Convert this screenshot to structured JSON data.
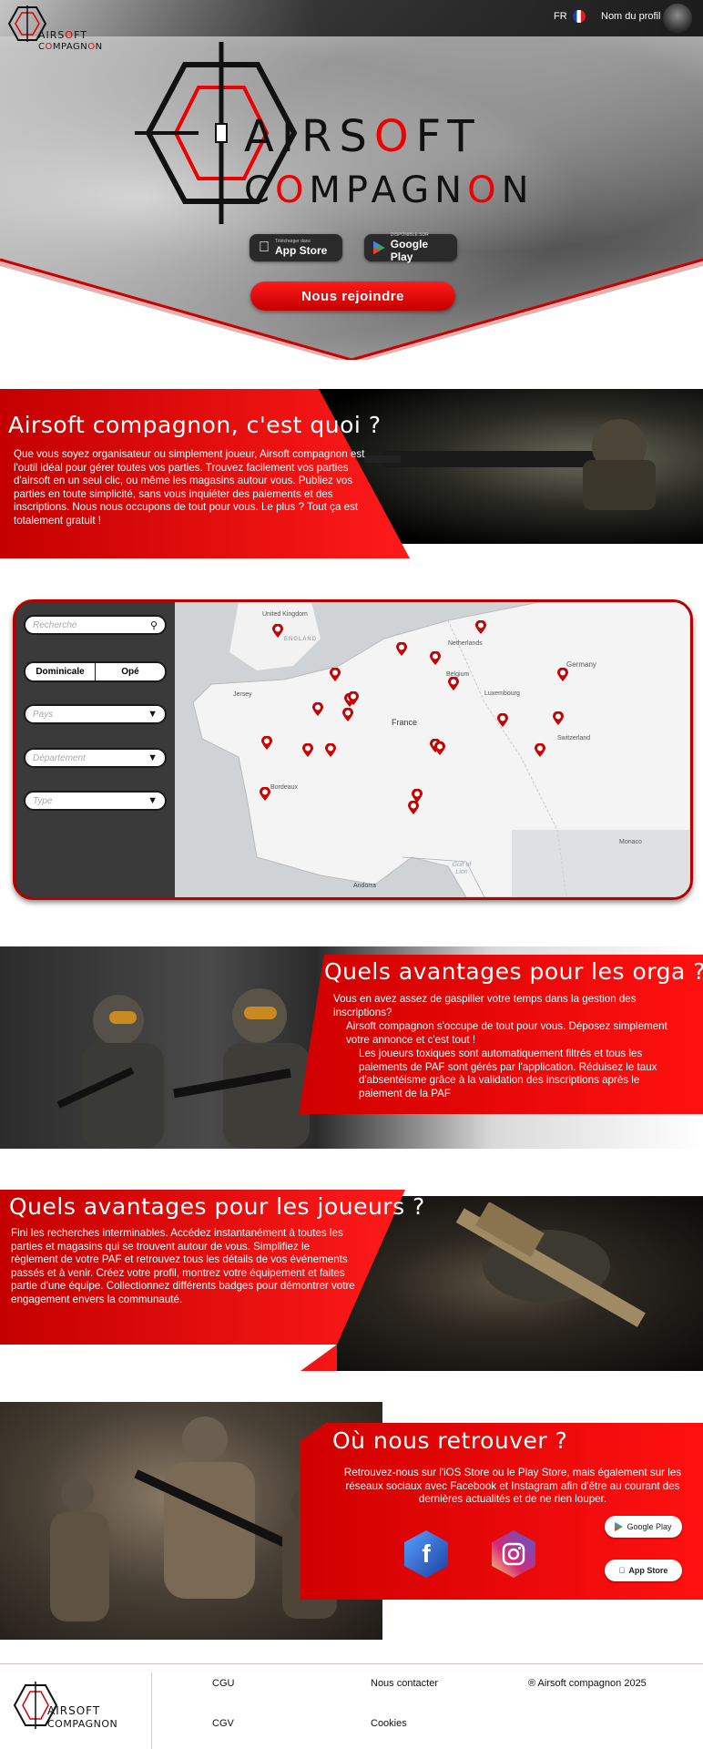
{
  "header": {
    "language": "FR",
    "profile_label": "Nom du profil"
  },
  "hero": {
    "logo_line1": "AIRSOFT",
    "logo_line2": "COMPAGNON",
    "app_store": {
      "small": "Télécharger dans",
      "label": "App Store"
    },
    "google_play": {
      "small": "DISPONIBLE SUR",
      "label": "Google Play"
    },
    "join_button": "Nous rejoindre"
  },
  "about": {
    "title": "Airsoft compagnon, c'est quoi ?",
    "text": "Que vous soyez organisateur ou simplement joueur, Airsoft compagnon est l'outil idéal pour gérer toutes vos parties. Trouvez facilement vos parties d'airsoft en un seul clic, ou même les magasins autour vous. Publiez vos parties en toute simplicité, sans vous inquiéter des paiements et des inscriptions. Nous nous occupons de tout pour vous. Le plus ? Tout ça est totalement gratuit !"
  },
  "search": {
    "search_placeholder": "Recherche",
    "segment": [
      "Dominicale",
      "Opé"
    ],
    "selects": [
      "Pays",
      "Département",
      "Type"
    ],
    "map_labels": [
      "United Kingdom",
      "ENGLAND",
      "Netherlands",
      "Belgium",
      "Luxembourg",
      "Germany",
      "Jersey",
      "France",
      "Switzerland",
      "Bordeaux",
      "Monaco",
      "Andorra",
      "Gulf of Lion"
    ]
  },
  "orga": {
    "title": "Quels avantages pour les orga ?",
    "p1": "Vous en avez assez de gaspiller votre temps dans la gestion des inscriptions?",
    "p2": "Airsoft compagnon s'occupe de tout pour vous. Déposez simplement votre annonce et c'est tout !",
    "p3": "Les joueurs toxiques sont automatiquement filtrés et tous les paiements de PAF sont gérés par l'application.  Réduisez le taux d'absentéisme grâce à la validation des inscriptions après le paiement de la PAF"
  },
  "players": {
    "title": "Quels avantages pour les joueurs ?",
    "text": "Fini les recherches interminables. Accédez instantanément à toutes les parties et magasins qui se trouvent autour de vous. Simplifiez le règlement de votre PAF et retrouvez tous les détails de vos événements passés et à venir. Créez votre profil, montrez votre équipement et faites partie d'une équipe. Collectionnez différents badges pour démontrer votre engagement envers la communauté."
  },
  "find": {
    "title": "Où nous retrouver ?",
    "text": "Retrouvez-nous sur l'iOS Store ou le Play Store, mais également sur les réseaux sociaux avec Facebook et Instagram afin d'être au courant des dernières actualités et de ne rien louper.",
    "facebook": "f",
    "google_play": "Google Play",
    "app_store": "App Store"
  },
  "footer": {
    "logo_line1": "AIRSOFT",
    "logo_line2": "COMPAGNON",
    "cgu": "CGU",
    "cgv": "CGV",
    "contact": "Nous contacter",
    "cookies": "Cookies",
    "copyright": "® Airsoft compagnon 2025"
  },
  "colors": {
    "accent": "#e00000",
    "dark": "#1c1c1c"
  }
}
